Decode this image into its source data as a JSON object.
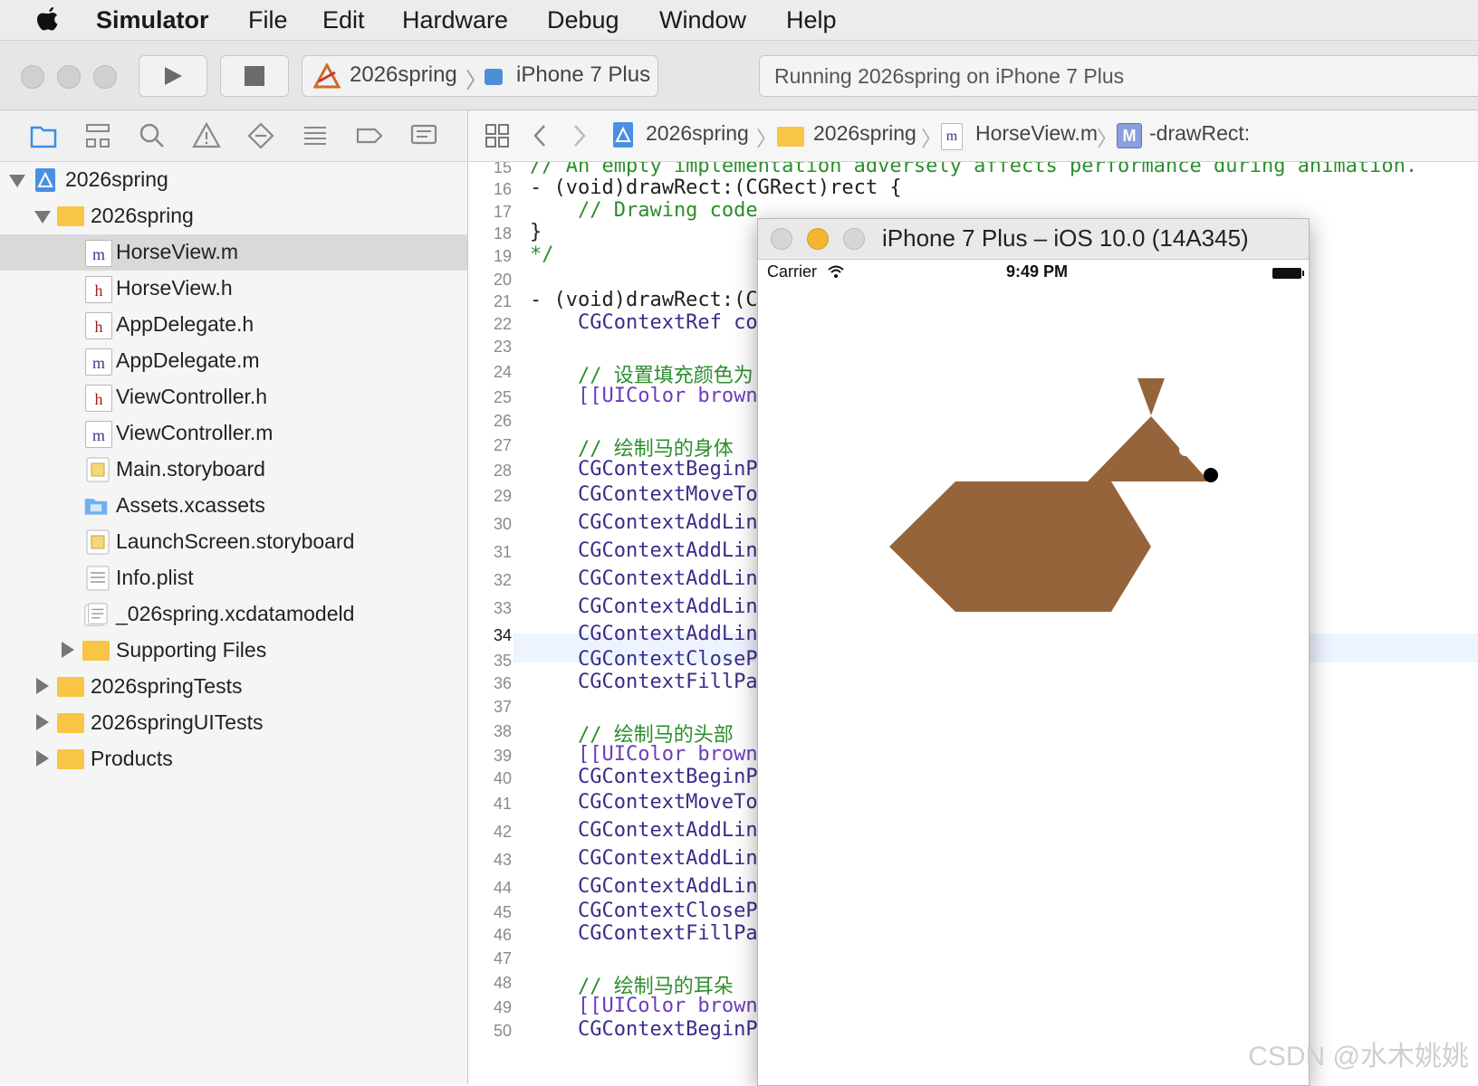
{
  "menubar": {
    "app": "Simulator",
    "items": [
      "File",
      "Edit",
      "Hardware",
      "Debug",
      "Window",
      "Help"
    ]
  },
  "toolbar": {
    "scheme_project": "2026spring",
    "scheme_device": "iPhone 7 Plus",
    "status": "Running 2026spring on iPhone 7 Plus"
  },
  "navigator": {
    "icons": [
      "folder-nav-icon",
      "hierarchy-icon",
      "search-icon",
      "warning-icon",
      "test-diamond-icon",
      "debug-list-icon",
      "breakpoint-icon",
      "report-icon"
    ],
    "items": [
      {
        "label": "2026spring",
        "kind": "project"
      },
      {
        "label": "2026spring",
        "kind": "folder"
      },
      {
        "label": "HorseView.m",
        "kind": "m"
      },
      {
        "label": "HorseView.h",
        "kind": "h"
      },
      {
        "label": "AppDelegate.h",
        "kind": "h"
      },
      {
        "label": "AppDelegate.m",
        "kind": "m"
      },
      {
        "label": "ViewController.h",
        "kind": "h"
      },
      {
        "label": "ViewController.m",
        "kind": "m"
      },
      {
        "label": "Main.storyboard",
        "kind": "storyboard"
      },
      {
        "label": "Assets.xcassets",
        "kind": "assets"
      },
      {
        "label": "LaunchScreen.storyboard",
        "kind": "storyboard"
      },
      {
        "label": "Info.plist",
        "kind": "plist"
      },
      {
        "label": "_026spring.xcdatamodeld",
        "kind": "datamodel"
      },
      {
        "label": "Supporting Files",
        "kind": "folder"
      },
      {
        "label": "2026springTests",
        "kind": "folder"
      },
      {
        "label": "2026springUITests",
        "kind": "folder"
      },
      {
        "label": "Products",
        "kind": "folder"
      }
    ]
  },
  "jumpbar": {
    "crumbs": [
      "2026spring",
      "2026spring",
      "HorseView.m",
      "-drawRect:"
    ]
  },
  "editor": {
    "lines": [
      {
        "n": "15",
        "text": "// An empty implementation adversely affects performance during animation."
      },
      {
        "n": "16",
        "text": "- (void)drawRect:(CGRect)rect {"
      },
      {
        "n": "17",
        "text": "    // Drawing code"
      },
      {
        "n": "18",
        "text": "}"
      },
      {
        "n": "19",
        "text": "*/"
      },
      {
        "n": "20",
        "text": ""
      },
      {
        "n": "21",
        "text": "- (void)drawRect:(C"
      },
      {
        "n": "22",
        "text": "    CGContextRef co"
      },
      {
        "n": "23",
        "text": ""
      },
      {
        "n": "24",
        "text": "    // 设置填充颜色为"
      },
      {
        "n": "25",
        "text": "    [[UIColor brown"
      },
      {
        "n": "26",
        "text": ""
      },
      {
        "n": "27",
        "text": "    // 绘制马的身体"
      },
      {
        "n": "28",
        "text": "    CGContextBeginP"
      },
      {
        "n": "29",
        "text": "    CGContextMoveTo"
      },
      {
        "n": "30",
        "text": "    CGContextAddLin"
      },
      {
        "n": "31",
        "text": "    CGContextAddLin"
      },
      {
        "n": "32",
        "text": "    CGContextAddLin"
      },
      {
        "n": "33",
        "text": "    CGContextAddLin"
      },
      {
        "n": "34",
        "text": "    CGContextAddLin"
      },
      {
        "n": "35",
        "text": "    CGContextCloseP"
      },
      {
        "n": "36",
        "text": "    CGContextFillPa"
      },
      {
        "n": "37",
        "text": ""
      },
      {
        "n": "38",
        "text": "    // 绘制马的头部"
      },
      {
        "n": "39",
        "text": "    [[UIColor brown"
      },
      {
        "n": "40",
        "text": "    CGContextBeginP"
      },
      {
        "n": "41",
        "text": "    CGContextMoveTo"
      },
      {
        "n": "42",
        "text": "    CGContextAddLin"
      },
      {
        "n": "43",
        "text": "    CGContextAddLin"
      },
      {
        "n": "44",
        "text": "    CGContextAddLin"
      },
      {
        "n": "45",
        "text": "    CGContextCloseP"
      },
      {
        "n": "46",
        "text": "    CGContextFillPa"
      },
      {
        "n": "47",
        "text": ""
      },
      {
        "n": "48",
        "text": "    // 绘制马的耳朵"
      },
      {
        "n": "49",
        "text": "    [[UIColor brown"
      },
      {
        "n": "50",
        "text": "    CGContextBeginP"
      }
    ],
    "current_line": "34"
  },
  "simulator": {
    "title": "iPhone 7 Plus – iOS 10.0 (14A345)",
    "carrier": "Carrier",
    "time": "9:49 PM",
    "horse_color": "#96643a"
  },
  "watermark": "CSDN @水木姚姚"
}
